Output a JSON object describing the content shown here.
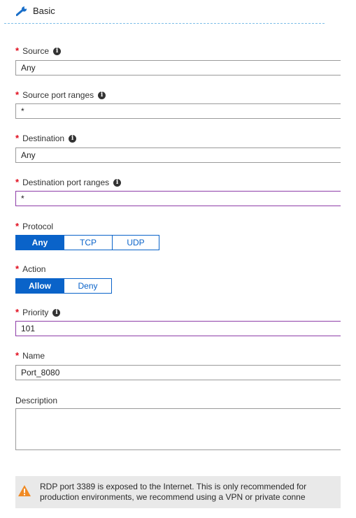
{
  "header": {
    "title": "Basic",
    "icon": "wrench-icon"
  },
  "colors": {
    "required": "#e00b1c",
    "accent": "#0a63c9",
    "focus": "#8e3da8",
    "divider": "#7dbde8"
  },
  "fields": {
    "source": {
      "label": "Source",
      "value": "Any"
    },
    "source_port_ranges": {
      "label": "Source port ranges",
      "value": "*"
    },
    "destination": {
      "label": "Destination",
      "value": "Any"
    },
    "destination_port_ranges": {
      "label": "Destination port ranges",
      "value": "*"
    },
    "priority": {
      "label": "Priority",
      "value": "101"
    },
    "name": {
      "label": "Name",
      "value": "Port_8080"
    },
    "description": {
      "label": "Description",
      "value": ""
    }
  },
  "protocol": {
    "label": "Protocol",
    "options": [
      "Any",
      "TCP",
      "UDP"
    ],
    "selected": "Any"
  },
  "action": {
    "label": "Action",
    "options": [
      "Allow",
      "Deny"
    ],
    "selected": "Allow"
  },
  "required_marker": "*",
  "info_glyph": "i",
  "warning": {
    "icon": "warning-triangle-icon",
    "line1": "RDP port 3389 is exposed to the Internet. This is only recommended for",
    "line2": "production environments, we recommend using a VPN or private conne"
  }
}
